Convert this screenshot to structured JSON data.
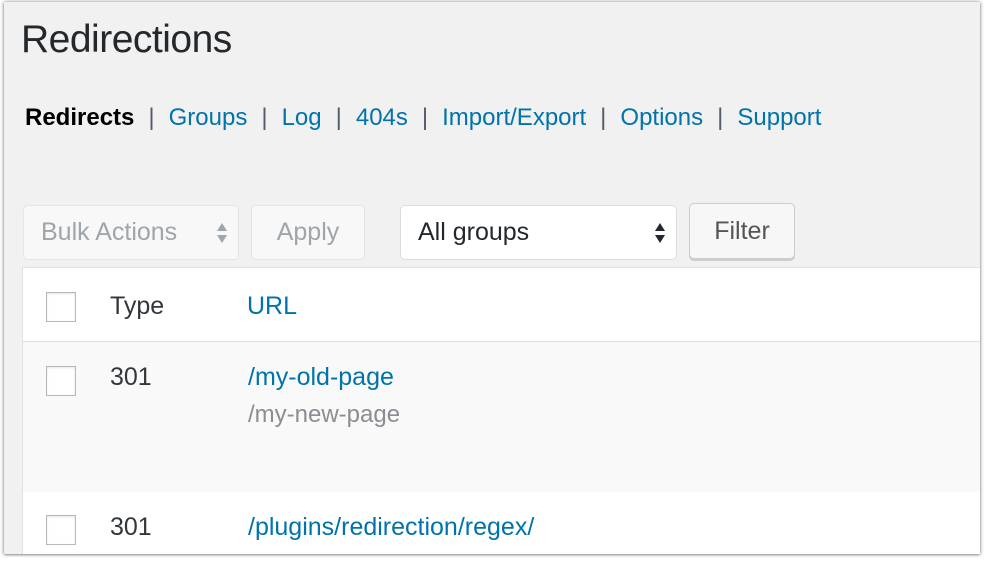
{
  "page": {
    "title": "Redirections"
  },
  "subnav": {
    "items": [
      {
        "label": "Redirects",
        "current": true
      },
      {
        "label": "Groups",
        "current": false
      },
      {
        "label": "Log",
        "current": false
      },
      {
        "label": "404s",
        "current": false
      },
      {
        "label": "Import/Export",
        "current": false
      },
      {
        "label": "Options",
        "current": false
      },
      {
        "label": "Support",
        "current": false
      }
    ],
    "separator": "|"
  },
  "toolbar": {
    "bulk_actions": {
      "selected": "Bulk Actions",
      "icon": "select-updown-icon"
    },
    "apply_label": "Apply",
    "group_filter": {
      "selected": "All groups",
      "icon": "select-updown-icon"
    },
    "filter_label": "Filter"
  },
  "table": {
    "columns": {
      "type": "Type",
      "url": "URL"
    },
    "rows": [
      {
        "type": "301",
        "source": "/my-old-page",
        "target": "/my-new-page"
      },
      {
        "type": "301",
        "source": "/plugins/redirection/regex/",
        "target": ""
      }
    ]
  },
  "colors": {
    "link": "#0073aa",
    "text": "#23282d",
    "muted_text": "#a0a5aa",
    "page_background": "#f1f1f1",
    "row_alt": "#f9f9f9"
  }
}
